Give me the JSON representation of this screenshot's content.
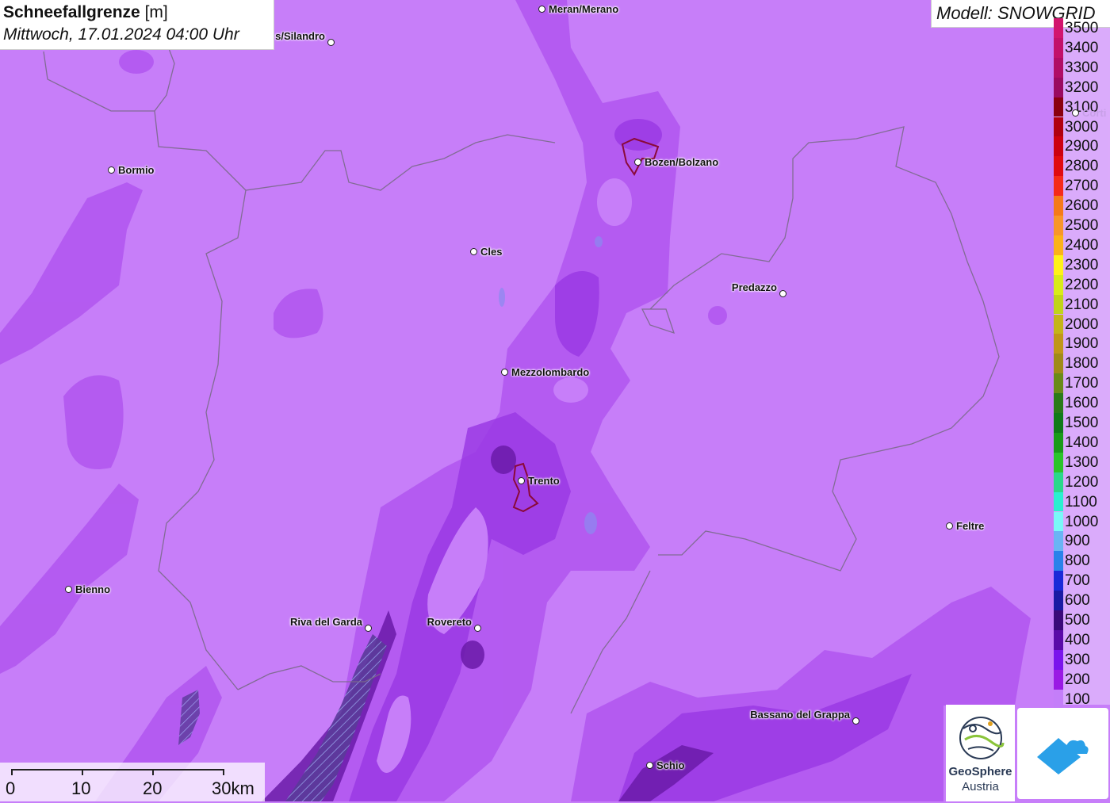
{
  "title": {
    "bold": "Schneefallgrenze",
    "unit": "[m]",
    "datetime": "Mittwoch, 17.01.2024 04:00 Uhr"
  },
  "model_label": "Modell: SNOWGRID",
  "legend": [
    {
      "label": "3500",
      "color": "#d2156e"
    },
    {
      "label": "3400",
      "color": "#c2116a"
    },
    {
      "label": "3300",
      "color": "#b00d66"
    },
    {
      "label": "3200",
      "color": "#9a0a60"
    },
    {
      "label": "3100",
      "color": "#8a0010"
    },
    {
      "label": "3000",
      "color": "#b00010"
    },
    {
      "label": "2900",
      "color": "#cc0010"
    },
    {
      "label": "2800",
      "color": "#e00a10"
    },
    {
      "label": "2700",
      "color": "#f52a1a"
    },
    {
      "label": "2600",
      "color": "#f57a1a"
    },
    {
      "label": "2500",
      "color": "#f8962a"
    },
    {
      "label": "2400",
      "color": "#fbb21a"
    },
    {
      "label": "2300",
      "color": "#fff21a"
    },
    {
      "label": "2200",
      "color": "#d8ec1a"
    },
    {
      "label": "2100",
      "color": "#c0d41a"
    },
    {
      "label": "2000",
      "color": "#c4b41a"
    },
    {
      "label": "1900",
      "color": "#c0961a"
    },
    {
      "label": "1800",
      "color": "#a08a1a"
    },
    {
      "label": "1700",
      "color": "#6a8a1a"
    },
    {
      "label": "1600",
      "color": "#2a7a1a"
    },
    {
      "label": "1500",
      "color": "#107a1a"
    },
    {
      "label": "1400",
      "color": "#1a9a1a"
    },
    {
      "label": "1300",
      "color": "#2ac42a"
    },
    {
      "label": "1200",
      "color": "#2ad88a"
    },
    {
      "label": "1100",
      "color": "#2af0d0"
    },
    {
      "label": "1000",
      "color": "#7af8f8"
    },
    {
      "label": "900",
      "color": "#6ab4f4"
    },
    {
      "label": "800",
      "color": "#2a82ea"
    },
    {
      "label": "700",
      "color": "#1a2ad8"
    },
    {
      "label": "600",
      "color": "#1a1aa4"
    },
    {
      "label": "500",
      "color": "#3a0a7a"
    },
    {
      "label": "400",
      "color": "#5a0aa8"
    },
    {
      "label": "300",
      "color": "#7a14ec"
    },
    {
      "label": "200",
      "color": "#9a1ae4"
    },
    {
      "label": "100",
      "color": "#c47ef9"
    }
  ],
  "cities": [
    {
      "name": "Meran/Merano"
    },
    {
      "name": "s/Silandro"
    },
    {
      "name": "Bormio"
    },
    {
      "name": "Bozen/Bolzano"
    },
    {
      "name": "Cles"
    },
    {
      "name": "Predazzo"
    },
    {
      "name": "Mezzolombardo"
    },
    {
      "name": "Trento"
    },
    {
      "name": "Feltre"
    },
    {
      "name": "Bienno"
    },
    {
      "name": "Riva del Garda"
    },
    {
      "name": "Rovereto"
    },
    {
      "name": "Bassano del Grappa"
    },
    {
      "name": "Schio"
    },
    {
      "name": "Corti"
    }
  ],
  "scale": {
    "labels": [
      "0",
      "10",
      "20",
      "30km"
    ]
  },
  "logo": {
    "line1": "GeoSphere",
    "line2": "Austria"
  }
}
